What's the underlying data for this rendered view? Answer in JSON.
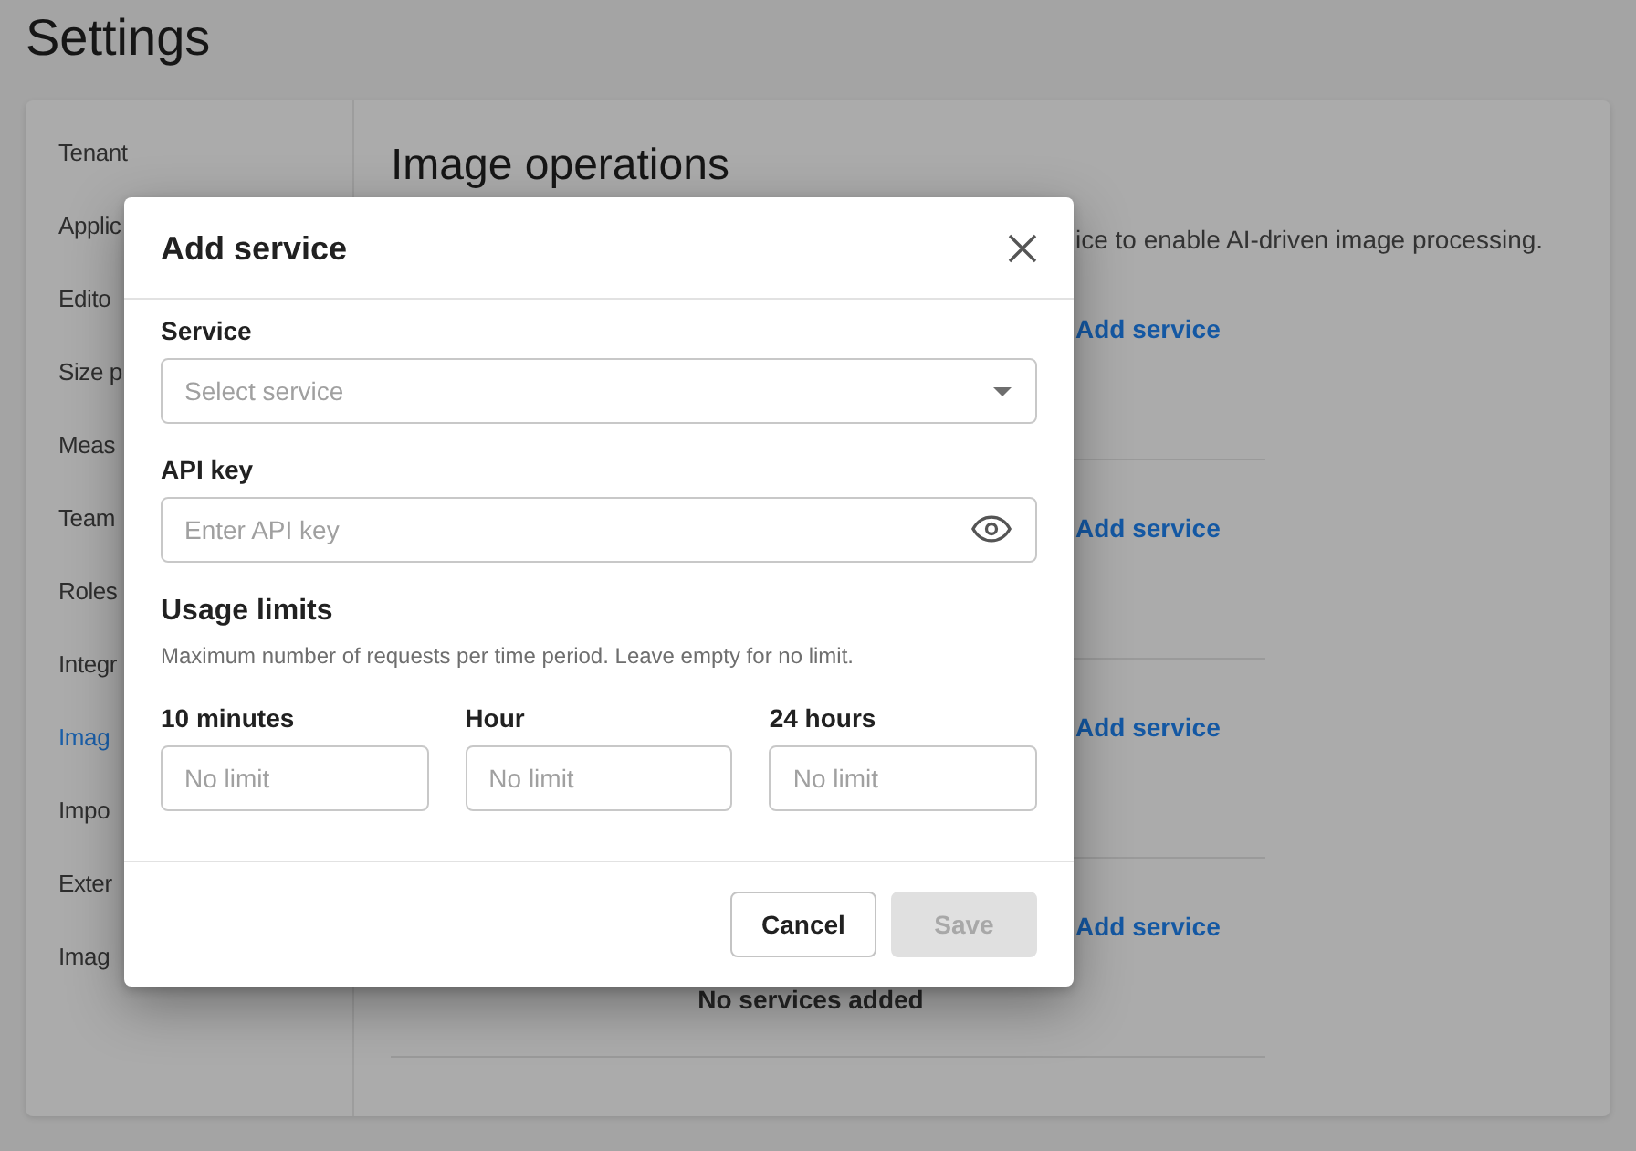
{
  "page": {
    "title": "Settings"
  },
  "sidebar": {
    "items": [
      {
        "label": "Tenant",
        "selected": false
      },
      {
        "label": "Applic",
        "selected": false
      },
      {
        "label": "Edito",
        "selected": false
      },
      {
        "label": "Size p",
        "selected": false
      },
      {
        "label": "Meas",
        "selected": false
      },
      {
        "label": "Team",
        "selected": false
      },
      {
        "label": "Roles",
        "selected": false
      },
      {
        "label": "Integr",
        "selected": false
      },
      {
        "label": "Imag",
        "selected": true
      },
      {
        "label": "Impo",
        "selected": false
      },
      {
        "label": "Exter",
        "selected": false
      },
      {
        "label": "Imag",
        "selected": false
      }
    ]
  },
  "main": {
    "title": "Image operations",
    "description": "ice to enable AI-driven image processing.",
    "sections": [
      {
        "action": "Add service"
      },
      {
        "action": "Add service"
      },
      {
        "action": "Add service"
      },
      {
        "action": "Add service",
        "empty_text": "No services added"
      }
    ]
  },
  "dialog": {
    "title": "Add service",
    "fields": [
      {
        "kind": "select",
        "label": "Service",
        "placeholder": "Select service"
      },
      {
        "kind": "secret",
        "label": "API key",
        "placeholder": "Enter API key"
      }
    ],
    "usage_limits": {
      "title": "Usage limits",
      "hint": "Maximum number of requests per time period. Leave empty for no limit.",
      "fields": [
        {
          "label": "10 minutes",
          "placeholder": "No limit"
        },
        {
          "label": "Hour",
          "placeholder": "No limit"
        },
        {
          "label": "24 hours",
          "placeholder": "No limit"
        }
      ]
    },
    "buttons": [
      {
        "label": "Cancel",
        "kind": "secondary",
        "disabled": false
      },
      {
        "label": "Save",
        "kind": "primary",
        "disabled": true
      }
    ]
  }
}
